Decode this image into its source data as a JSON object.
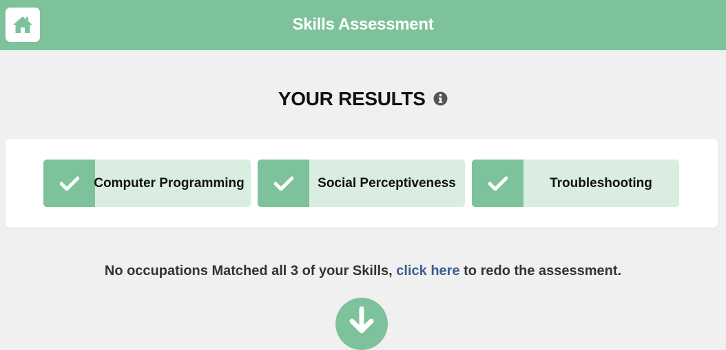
{
  "header": {
    "title": "Skills Assessment",
    "home_icon": "home-icon"
  },
  "results": {
    "title": "YOUR RESULTS",
    "info_icon": "info-icon"
  },
  "skills": [
    {
      "label": "Computer Programming",
      "icon": "check-icon"
    },
    {
      "label": "Social Perceptiveness",
      "icon": "check-icon"
    },
    {
      "label": "Troubleshooting",
      "icon": "check-icon"
    }
  ],
  "message": {
    "prefix": "No occupations Matched all 3 of your Skills, ",
    "link": "click here",
    "suffix": " to redo the assessment."
  },
  "colors": {
    "accent": "#7dc29b",
    "accent_light": "#d9ede1",
    "link": "#3b5d91",
    "background": "#f0f0f0"
  }
}
